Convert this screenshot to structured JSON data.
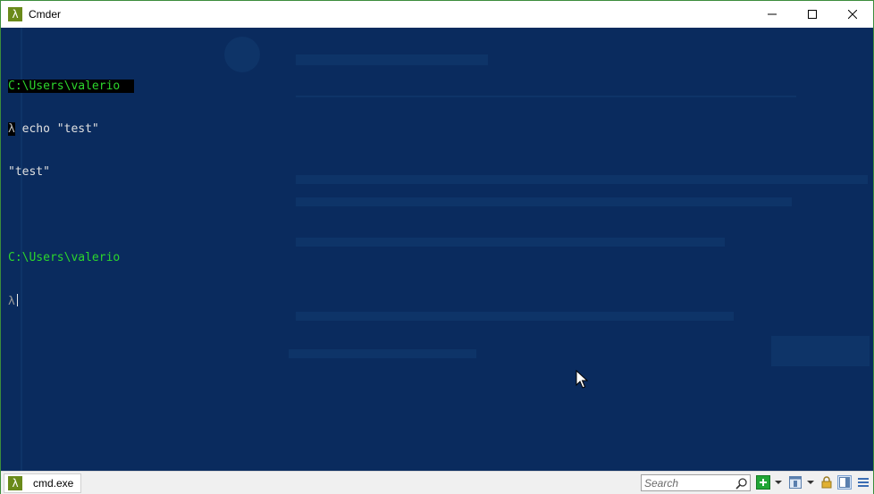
{
  "window": {
    "title": "Cmder",
    "app_icon_glyph": "λ"
  },
  "titlebar_buttons": {
    "minimize": "minimize-icon",
    "maximize": "maximize-icon",
    "close": "close-icon"
  },
  "terminal": {
    "lines": [
      {
        "path": "C:\\Users\\valerio"
      },
      {
        "prompt": "λ",
        "command": " echo \"test\""
      },
      {
        "output": "\"test\""
      },
      {
        "blank": ""
      },
      {
        "path": "C:\\Users\\valerio"
      },
      {
        "prompt": "λ"
      }
    ]
  },
  "statusbar": {
    "tab_label": "cmd.exe",
    "tab_icon_glyph": "λ",
    "search_placeholder": "Search"
  },
  "colors": {
    "console_bg": "#0a2b5e",
    "path_green": "#2cd62c",
    "frame_green": "#3c8d3c",
    "app_icon_bg": "#6a8a1a"
  }
}
